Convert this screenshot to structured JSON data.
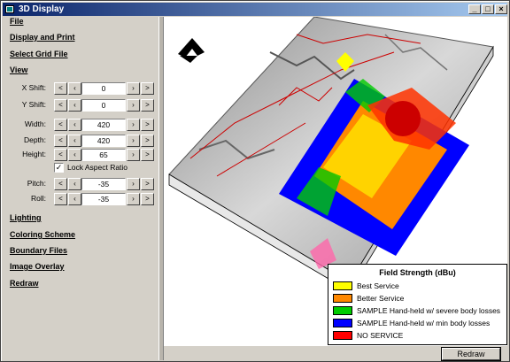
{
  "window": {
    "title": "3D Display"
  },
  "sidebar": {
    "menu_top": [
      "File",
      "Display and Print",
      "Select Grid File",
      "View"
    ],
    "fields": [
      {
        "label": "X Shift:",
        "value": "0"
      },
      {
        "label": "Y Shift:",
        "value": "0"
      },
      {
        "label": "Width:",
        "value": "420"
      },
      {
        "label": "Depth:",
        "value": "420"
      },
      {
        "label": "Height:",
        "value": "65"
      },
      {
        "label": "Pitch:",
        "value": "-35"
      },
      {
        "label": "Roll:",
        "value": "-35"
      }
    ],
    "lock_aspect": {
      "label": "Lock Aspect Ratio",
      "checked": true
    },
    "menu_bottom": [
      "Lighting",
      "Coloring Scheme",
      "Boundary Files",
      "Image Overlay",
      "Redraw"
    ]
  },
  "legend": {
    "title": "Field Strength (dBu)",
    "items": [
      {
        "label": "Best Service",
        "color": "#ffff00"
      },
      {
        "label": "Better Service",
        "color": "#ff8800"
      },
      {
        "label": "SAMPLE Hand-held w/ severe body losses",
        "color": "#00cc00"
      },
      {
        "label": "SAMPLE Hand-held w/ min body losses",
        "color": "#0000ff"
      },
      {
        "label": "NO SERVICE",
        "color": "#ff0000"
      }
    ]
  },
  "statusbar": {
    "redraw_label": "Redraw"
  }
}
